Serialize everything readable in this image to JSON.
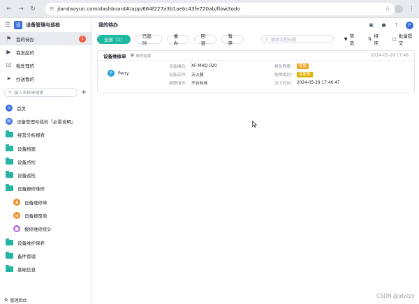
{
  "browser": {
    "url": "jiandaoyun.com/dashboard#/app/664f227a3b1aebc43fe720ab/flow/todo"
  },
  "app": {
    "title": "设备管理与巡检",
    "logo_glyph": "设"
  },
  "sidebar": {
    "quick": [
      {
        "label": "我的待办",
        "icon": "bell-icon",
        "badge": "1",
        "active": true
      },
      {
        "label": "我发起的",
        "icon": "play-icon"
      },
      {
        "label": "我处理的",
        "icon": "check-icon"
      },
      {
        "label": "抄送我的",
        "icon": "send-icon"
      }
    ],
    "search_placeholder": "输入名称来搜索",
    "tree": [
      {
        "label": "首页",
        "icon": "home-icon",
        "color": "#3b6fe0"
      },
      {
        "label": "设备管理与巡检『必看说明』",
        "icon": "doc-icon",
        "color": "#3b6fe0"
      },
      {
        "label": "经营分析报表",
        "icon": "folder-icon"
      },
      {
        "label": "设备档案",
        "icon": "folder-icon"
      },
      {
        "label": "设备点检",
        "icon": "folder-icon"
      },
      {
        "label": "设备巡检",
        "icon": "folder-icon"
      },
      {
        "label": "设备报修维修",
        "icon": "folder-icon"
      },
      {
        "label": "设备维修单",
        "icon": "warning-icon",
        "color": "#f08a24",
        "sub": true
      },
      {
        "label": "设备报废单",
        "icon": "doc-icon",
        "color": "#f08a24",
        "sub": true
      },
      {
        "label": "报修维修统计",
        "icon": "chart-icon",
        "color": "#b56ae0",
        "sub": true
      },
      {
        "label": "设备维护保养",
        "icon": "folder-icon"
      },
      {
        "label": "备件管理",
        "icon": "folder-icon"
      },
      {
        "label": "基础信息",
        "icon": "folder-icon"
      }
    ],
    "footer": "管理后台"
  },
  "header": {
    "title": "我的待办",
    "avatar_letter": "P"
  },
  "filters": {
    "tabs": [
      "全部（1）",
      "已超时",
      "催办",
      "回退",
      "暂存"
    ],
    "search_placeholder": "搜索流程标题",
    "filter_label": "筛选",
    "sort_label": "排序",
    "batch_label": "批量提交"
  },
  "card": {
    "title": "设备维修单",
    "node": "维修结果",
    "date": "2024-05-29 17:46",
    "person_initial": "P",
    "person": "Perry",
    "fields": {
      "code_label": "设备编码：",
      "code_value": "XF-MHQ-020",
      "name_label": "设备名称：",
      "name_value": "灭火器",
      "desc_label": "故障描述：",
      "desc_value": "不合标准",
      "urgency_label": "紧急程度：",
      "urgency_value": "紧急",
      "urgency_color": "#f5a623",
      "category_label": "故障类别：",
      "category_value": "需更换",
      "category_color": "#e0b000",
      "time_label": "派工时间：",
      "time_value": "2024-05-29 17:46:47"
    }
  },
  "watermark": "CSDN @jdyzzy"
}
